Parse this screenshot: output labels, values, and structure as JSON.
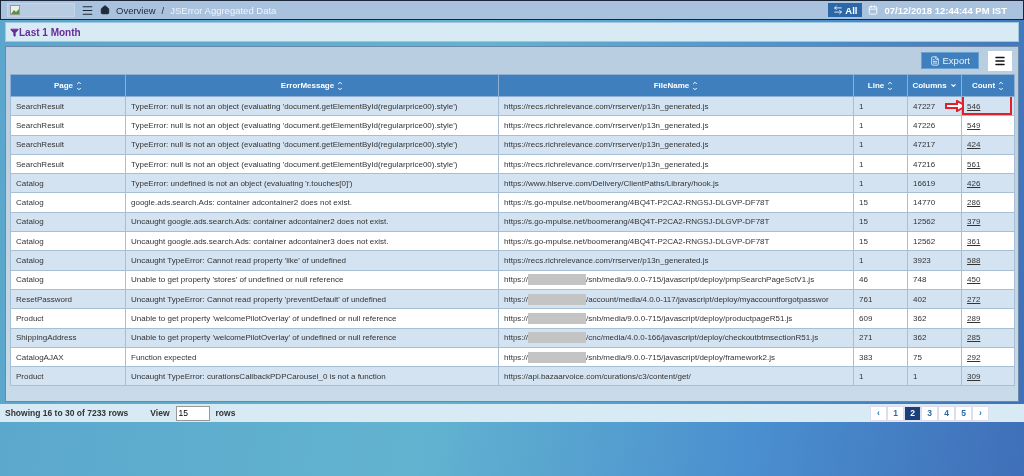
{
  "topbar": {
    "breadcrumb": [
      {
        "label": "Overview"
      },
      {
        "label": "JSError Aggregated Data"
      }
    ],
    "separator": "/",
    "scope_button": "All",
    "datetime": "07/12/2018 12:44:44 PM IST"
  },
  "filter": {
    "label": "Last 1 Month"
  },
  "toolbar": {
    "export": "Export"
  },
  "table": {
    "columns": [
      {
        "label": "Page",
        "sorted": false
      },
      {
        "label": "ErrorMessage",
        "sorted": false
      },
      {
        "label": "FileName",
        "sorted": false
      },
      {
        "label": "Line",
        "sorted": false
      },
      {
        "label": "Columns",
        "sorted": true
      },
      {
        "label": "Count",
        "sorted": false
      }
    ],
    "rows": [
      {
        "page": "SearchResult",
        "message": "TypeError: null is not an object (evaluating 'document.getElementById(regularprice00).style')",
        "file": "https://recs.richrelevance.com/rrserver/p13n_generated.js",
        "redacted": false,
        "line": "1",
        "columns": "47227",
        "count": "546",
        "highlighted": true
      },
      {
        "page": "SearchResult",
        "message": "TypeError: null is not an object (evaluating 'document.getElementById(regularprice00).style')",
        "file": "https://recs.richrelevance.com/rrserver/p13n_generated.js",
        "redacted": false,
        "line": "1",
        "columns": "47226",
        "count": "549",
        "highlighted": false
      },
      {
        "page": "SearchResult",
        "message": "TypeError: null is not an object (evaluating 'document.getElementById(regularprice00).style')",
        "file": "https://recs.richrelevance.com/rrserver/p13n_generated.js",
        "redacted": false,
        "line": "1",
        "columns": "47217",
        "count": "424",
        "highlighted": false
      },
      {
        "page": "SearchResult",
        "message": "TypeError: null is not an object (evaluating 'document.getElementById(regularprice00).style')",
        "file": "https://recs.richrelevance.com/rrserver/p13n_generated.js",
        "redacted": false,
        "line": "1",
        "columns": "47216",
        "count": "561",
        "highlighted": false
      },
      {
        "page": "Catalog",
        "message": "TypeError: undefined is not an object (evaluating 'r.touches[0]')",
        "file": "https://www.hlserve.com/Delivery/ClientPaths/Library/hook.js",
        "redacted": false,
        "line": "1",
        "columns": "16619",
        "count": "426",
        "highlighted": false
      },
      {
        "page": "Catalog",
        "message": "google.ads.search.Ads: container adcontainer2 does not exist.",
        "file": "https://s.go-mpulse.net/boomerang/4BQ4T-P2CA2-RNGSJ-DLGVP-DF78T",
        "redacted": false,
        "line": "15",
        "columns": "14770",
        "count": "286",
        "highlighted": false
      },
      {
        "page": "Catalog",
        "message": "Uncaught google.ads.search.Ads: container adcontainer2 does not exist.",
        "file": "https://s.go-mpulse.net/boomerang/4BQ4T-P2CA2-RNGSJ-DLGVP-DF78T",
        "redacted": false,
        "line": "15",
        "columns": "12562",
        "count": "379",
        "highlighted": false
      },
      {
        "page": "Catalog",
        "message": "Uncaught google.ads.search.Ads: container adcontainer3 does not exist.",
        "file": "https://s.go-mpulse.net/boomerang/4BQ4T-P2CA2-RNGSJ-DLGVP-DF78T",
        "redacted": false,
        "line": "15",
        "columns": "12562",
        "count": "361",
        "highlighted": false
      },
      {
        "page": "Catalog",
        "message": "Uncaught TypeError: Cannot read property 'like' of undefined",
        "file": "https://recs.richrelevance.com/rrserver/p13n_generated.js",
        "redacted": false,
        "line": "1",
        "columns": "3923",
        "count": "588",
        "highlighted": false
      },
      {
        "page": "Catalog",
        "message": "Unable to get property 'stores' of undefined or null reference",
        "file": "https://",
        "redacted": true,
        "file_rest": "/snb/media/9.0.0-715/javascript/deploy/pmpSearchPageSctV1.js",
        "line": "46",
        "columns": "748",
        "count": "450",
        "highlighted": false
      },
      {
        "page": "ResetPassword",
        "message": "Uncaught TypeError: Cannot read property 'preventDefault' of undefined",
        "file": "https://",
        "redacted": true,
        "file_rest": "/account/media/4.0.0-117/javascript/deploy/myaccountforgotpasswor",
        "line": "761",
        "columns": "402",
        "count": "272",
        "highlighted": false
      },
      {
        "page": "Product",
        "message": "Unable to get property 'welcomePilotOverlay' of undefined or null reference",
        "file": "https://",
        "redacted": true,
        "file_rest": "/snb/media/9.0.0-715/javascript/deploy/productpageR51.js",
        "line": "609",
        "columns": "362",
        "count": "289",
        "highlighted": false
      },
      {
        "page": "ShippingAddress",
        "message": "Unable to get property 'welcomePilotOverlay' of undefined or null reference",
        "file": "https://",
        "redacted": true,
        "file_rest": "/cnc/media/4.0.0-166/javascript/deploy/checkoutbtmsectionR51.js",
        "line": "271",
        "columns": "362",
        "count": "285",
        "highlighted": false
      },
      {
        "page": "CatalogAJAX",
        "message": "Function expected",
        "file": "https://",
        "redacted": true,
        "file_rest": "/snb/media/9.0.0-715/javascript/deploy/framework2.js",
        "line": "383",
        "columns": "75",
        "count": "292",
        "highlighted": false
      },
      {
        "page": "Product",
        "message": "Uncaught TypeError: curationsCallbackPDPCarousel_0 is not a function",
        "file": "https://api.bazaarvoice.com/curations/c3/content/get/",
        "redacted": false,
        "line": "1",
        "columns": "1",
        "count": "309",
        "highlighted": false
      }
    ]
  },
  "footer": {
    "showing": "Showing 16 to 30 of 7233 rows",
    "view_label": "View",
    "view_value": "15",
    "rows_label": "rows",
    "pagination": {
      "prev": "‹",
      "next": "›",
      "pages": [
        {
          "label": "1",
          "selected": false
        },
        {
          "label": "2",
          "selected": true
        },
        {
          "label": "3",
          "selected": false
        },
        {
          "label": "4",
          "selected": false
        },
        {
          "label": "5",
          "selected": false
        }
      ]
    }
  }
}
